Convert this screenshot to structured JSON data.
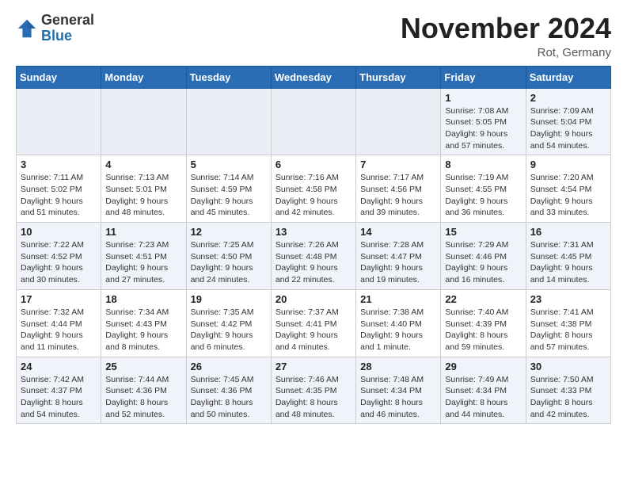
{
  "header": {
    "logo_general": "General",
    "logo_blue": "Blue",
    "month_title": "November 2024",
    "location": "Rot, Germany"
  },
  "weekdays": [
    "Sunday",
    "Monday",
    "Tuesday",
    "Wednesday",
    "Thursday",
    "Friday",
    "Saturday"
  ],
  "weeks": [
    [
      {
        "day": "",
        "info": ""
      },
      {
        "day": "",
        "info": ""
      },
      {
        "day": "",
        "info": ""
      },
      {
        "day": "",
        "info": ""
      },
      {
        "day": "",
        "info": ""
      },
      {
        "day": "1",
        "info": "Sunrise: 7:08 AM\nSunset: 5:05 PM\nDaylight: 9 hours\nand 57 minutes."
      },
      {
        "day": "2",
        "info": "Sunrise: 7:09 AM\nSunset: 5:04 PM\nDaylight: 9 hours\nand 54 minutes."
      }
    ],
    [
      {
        "day": "3",
        "info": "Sunrise: 7:11 AM\nSunset: 5:02 PM\nDaylight: 9 hours\nand 51 minutes."
      },
      {
        "day": "4",
        "info": "Sunrise: 7:13 AM\nSunset: 5:01 PM\nDaylight: 9 hours\nand 48 minutes."
      },
      {
        "day": "5",
        "info": "Sunrise: 7:14 AM\nSunset: 4:59 PM\nDaylight: 9 hours\nand 45 minutes."
      },
      {
        "day": "6",
        "info": "Sunrise: 7:16 AM\nSunset: 4:58 PM\nDaylight: 9 hours\nand 42 minutes."
      },
      {
        "day": "7",
        "info": "Sunrise: 7:17 AM\nSunset: 4:56 PM\nDaylight: 9 hours\nand 39 minutes."
      },
      {
        "day": "8",
        "info": "Sunrise: 7:19 AM\nSunset: 4:55 PM\nDaylight: 9 hours\nand 36 minutes."
      },
      {
        "day": "9",
        "info": "Sunrise: 7:20 AM\nSunset: 4:54 PM\nDaylight: 9 hours\nand 33 minutes."
      }
    ],
    [
      {
        "day": "10",
        "info": "Sunrise: 7:22 AM\nSunset: 4:52 PM\nDaylight: 9 hours\nand 30 minutes."
      },
      {
        "day": "11",
        "info": "Sunrise: 7:23 AM\nSunset: 4:51 PM\nDaylight: 9 hours\nand 27 minutes."
      },
      {
        "day": "12",
        "info": "Sunrise: 7:25 AM\nSunset: 4:50 PM\nDaylight: 9 hours\nand 24 minutes."
      },
      {
        "day": "13",
        "info": "Sunrise: 7:26 AM\nSunset: 4:48 PM\nDaylight: 9 hours\nand 22 minutes."
      },
      {
        "day": "14",
        "info": "Sunrise: 7:28 AM\nSunset: 4:47 PM\nDaylight: 9 hours\nand 19 minutes."
      },
      {
        "day": "15",
        "info": "Sunrise: 7:29 AM\nSunset: 4:46 PM\nDaylight: 9 hours\nand 16 minutes."
      },
      {
        "day": "16",
        "info": "Sunrise: 7:31 AM\nSunset: 4:45 PM\nDaylight: 9 hours\nand 14 minutes."
      }
    ],
    [
      {
        "day": "17",
        "info": "Sunrise: 7:32 AM\nSunset: 4:44 PM\nDaylight: 9 hours\nand 11 minutes."
      },
      {
        "day": "18",
        "info": "Sunrise: 7:34 AM\nSunset: 4:43 PM\nDaylight: 9 hours\nand 8 minutes."
      },
      {
        "day": "19",
        "info": "Sunrise: 7:35 AM\nSunset: 4:42 PM\nDaylight: 9 hours\nand 6 minutes."
      },
      {
        "day": "20",
        "info": "Sunrise: 7:37 AM\nSunset: 4:41 PM\nDaylight: 9 hours\nand 4 minutes."
      },
      {
        "day": "21",
        "info": "Sunrise: 7:38 AM\nSunset: 4:40 PM\nDaylight: 9 hours\nand 1 minute."
      },
      {
        "day": "22",
        "info": "Sunrise: 7:40 AM\nSunset: 4:39 PM\nDaylight: 8 hours\nand 59 minutes."
      },
      {
        "day": "23",
        "info": "Sunrise: 7:41 AM\nSunset: 4:38 PM\nDaylight: 8 hours\nand 57 minutes."
      }
    ],
    [
      {
        "day": "24",
        "info": "Sunrise: 7:42 AM\nSunset: 4:37 PM\nDaylight: 8 hours\nand 54 minutes."
      },
      {
        "day": "25",
        "info": "Sunrise: 7:44 AM\nSunset: 4:36 PM\nDaylight: 8 hours\nand 52 minutes."
      },
      {
        "day": "26",
        "info": "Sunrise: 7:45 AM\nSunset: 4:36 PM\nDaylight: 8 hours\nand 50 minutes."
      },
      {
        "day": "27",
        "info": "Sunrise: 7:46 AM\nSunset: 4:35 PM\nDaylight: 8 hours\nand 48 minutes."
      },
      {
        "day": "28",
        "info": "Sunrise: 7:48 AM\nSunset: 4:34 PM\nDaylight: 8 hours\nand 46 minutes."
      },
      {
        "day": "29",
        "info": "Sunrise: 7:49 AM\nSunset: 4:34 PM\nDaylight: 8 hours\nand 44 minutes."
      },
      {
        "day": "30",
        "info": "Sunrise: 7:50 AM\nSunset: 4:33 PM\nDaylight: 8 hours\nand 42 minutes."
      }
    ]
  ]
}
